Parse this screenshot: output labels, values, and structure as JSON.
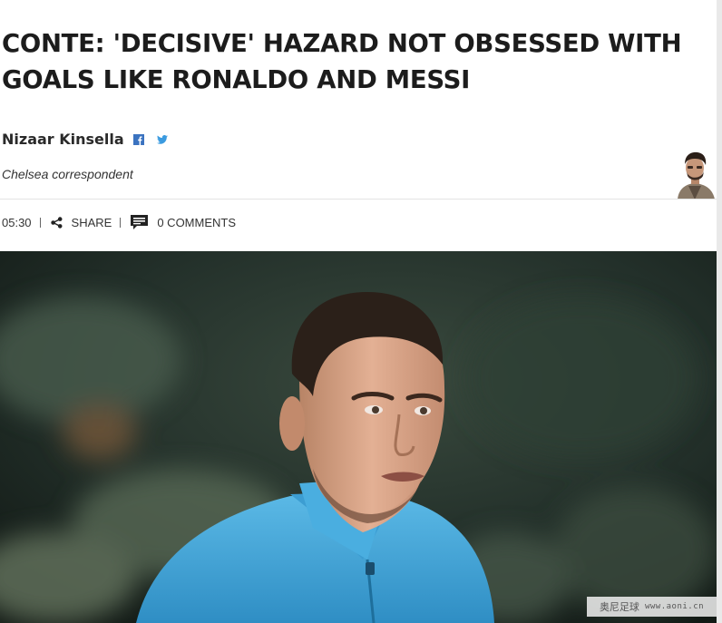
{
  "article": {
    "headline": "CONTE: 'DECISIVE' HAZARD NOT OBSESSED WITH GOALS LIKE RONALDO AND MESSI",
    "author": {
      "name": "Nizaar Kinsella",
      "role": "Chelsea correspondent"
    },
    "social_icons": [
      "facebook-icon",
      "twitter-icon"
    ],
    "meta": {
      "time": "05:30",
      "share_label": "SHARE",
      "comments_label": "0 COMMENTS"
    }
  },
  "watermark": {
    "brand": "奥尼足球",
    "url": "www.aoni.cn"
  },
  "colors": {
    "headline": "#1c1c1c",
    "social_icon": "#3b73c0",
    "jersey": "#3f9fd1",
    "divider": "#e3e3e3"
  }
}
